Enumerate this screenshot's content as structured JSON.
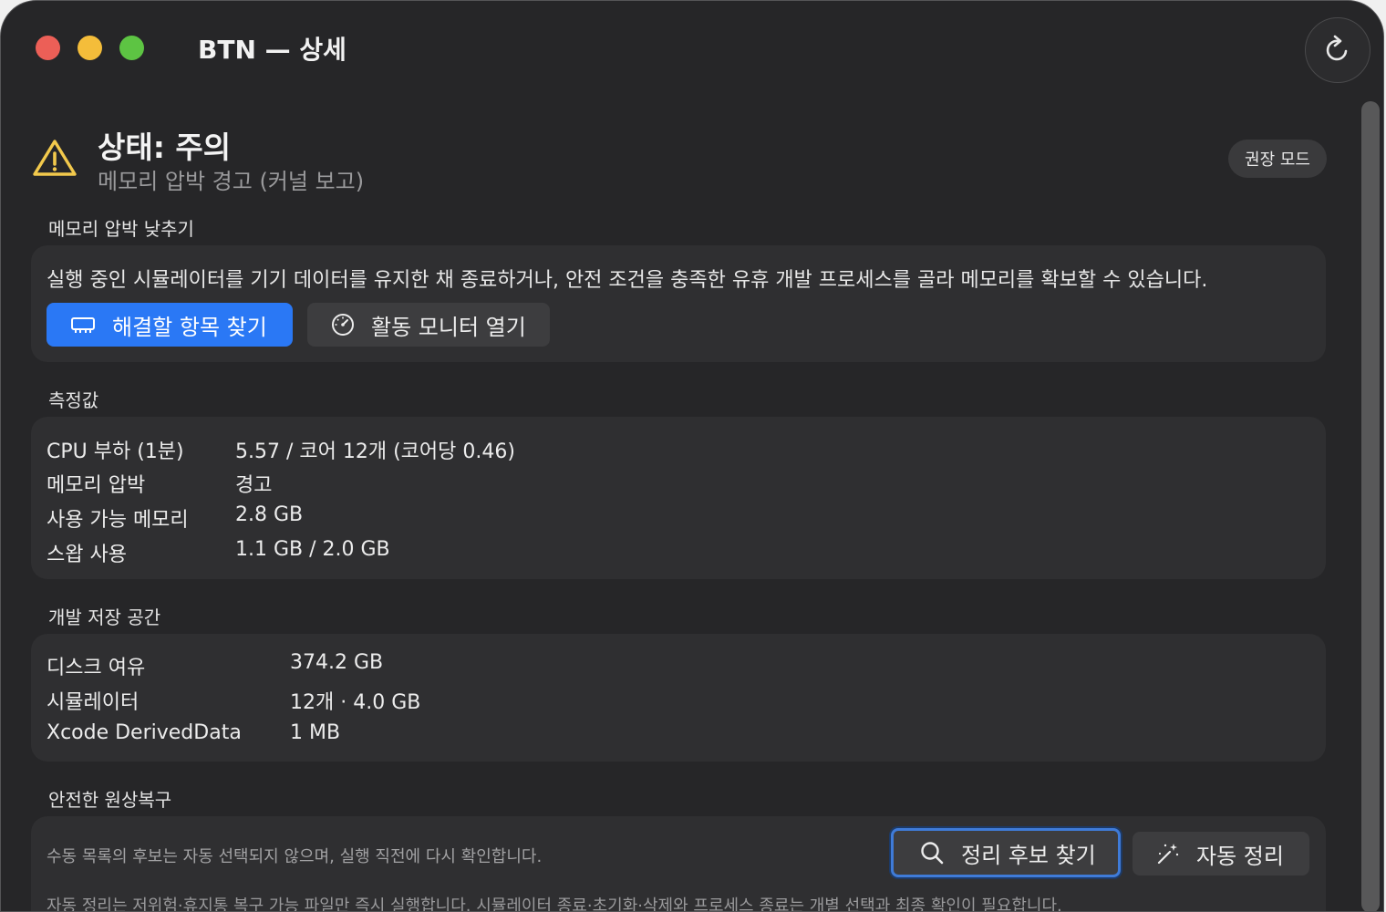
{
  "window": {
    "title": "BTN — 상세",
    "refresh_icon": "refresh-icon",
    "scrollbar": {
      "position_pct": 0
    }
  },
  "status": {
    "icon": "warning-triangle-icon",
    "title": "상태: 주의",
    "subtitle": "메모리 압박 경고 (커널 보고)",
    "mode_badge": "권장 모드",
    "accent_color": "#f2c94c"
  },
  "memory_relief": {
    "label": "메모리 압박 낮추기",
    "description": "실행 중인 시뮬레이터를 기기 데이터를 유지한 채 종료하거나, 안전 조건을 충족한 유휴 개발 프로세스를 골라 메모리를 확보할 수 있습니다.",
    "find_button": {
      "label": "해결할 항목 찾기",
      "icon": "memory-chip-icon"
    },
    "monitor_button": {
      "label": "활동 모니터 열기",
      "icon": "gauge-icon"
    }
  },
  "metrics": {
    "label": "측정값",
    "rows": [
      {
        "key": "CPU 부하 (1분)",
        "value": "5.57 / 코어 12개 (코어당 0.46)"
      },
      {
        "key": "메모리 압박",
        "value": "경고"
      },
      {
        "key": "사용 가능 메모리",
        "value": "2.8 GB"
      },
      {
        "key": "스왑 사용",
        "value": "1.1 GB / 2.0 GB"
      }
    ]
  },
  "storage": {
    "label": "개발 저장 공간",
    "rows": [
      {
        "key": "디스크 여유",
        "value": "374.2 GB"
      },
      {
        "key": "시뮬레이터",
        "value": "12개 · 4.0 GB"
      },
      {
        "key": "Xcode DerivedData",
        "value": "1 MB"
      }
    ]
  },
  "restore": {
    "label": "안전한 원상복구",
    "note": "수동 목록의 후보는 자동 선택되지 않으며, 실행 직전에 다시 확인합니다.",
    "find_button": {
      "label": "정리 후보 찾기",
      "icon": "search-icon"
    },
    "auto_button": {
      "label": "자동 정리",
      "icon": "magic-wand-icon"
    },
    "footer": "자동 정리는 저위험·휴지통 복구 가능 파일만 즉시 실행합니다. 시뮬레이터 종료·초기화·삭제와 프로세스 종료는 개별 선택과 최종 확인이 필요합니다."
  }
}
